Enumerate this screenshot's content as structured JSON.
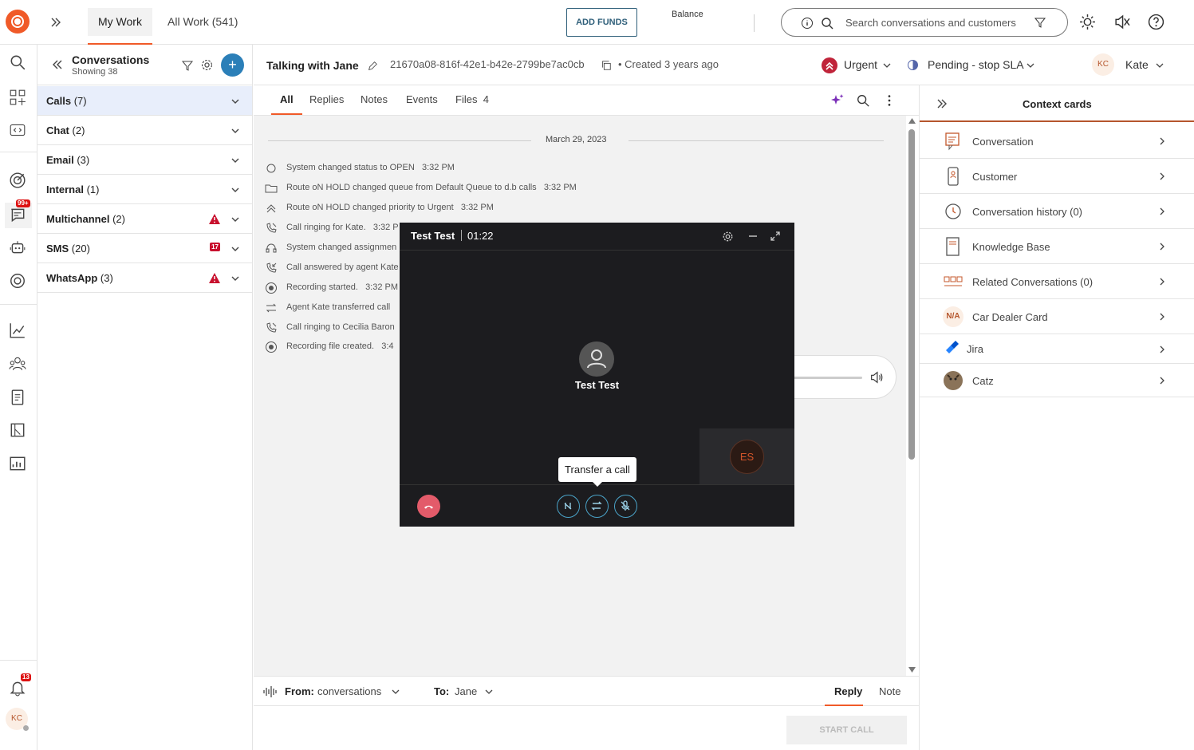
{
  "topbar": {
    "tabs": [
      {
        "label": "My Work",
        "active": true
      },
      {
        "label": "All Work (541)",
        "active": false
      }
    ],
    "add_funds_label": "ADD FUNDS",
    "balance_label": "Balance",
    "search_placeholder": "Search conversations and customers",
    "icons": [
      "info-icon",
      "search-icon",
      "filter-icon",
      "sun-icon",
      "mute-icon",
      "help-icon"
    ]
  },
  "rail": {
    "chat_badge": "99+",
    "notif_badge": "13",
    "avatar": "KC"
  },
  "conversations": {
    "title": "Conversations",
    "showing": "Showing 38",
    "groups": [
      {
        "name": "Calls",
        "count": "(7)",
        "active": true
      },
      {
        "name": "Chat",
        "count": "(2)"
      },
      {
        "name": "Email",
        "count": "(3)"
      },
      {
        "name": "Internal",
        "count": "(1)"
      },
      {
        "name": "Multichannel",
        "count": "(2)",
        "flag": "warning"
      },
      {
        "name": "SMS",
        "count": "(20)",
        "flag": "17"
      },
      {
        "name": "WhatsApp",
        "count": "(3)",
        "flag": "warning"
      }
    ]
  },
  "header": {
    "title": "Talking with Jane",
    "conversation_id": "21670a08-816f-42e1-b42e-2799be7ac0cb",
    "created": "• Created 3 years ago",
    "priority": "Urgent",
    "status": "Pending - stop SLA",
    "agent_initials": "KC",
    "agent_name": "Kate"
  },
  "tabs": [
    {
      "label": "All",
      "active": true
    },
    {
      "label": "Replies"
    },
    {
      "label": "Notes"
    },
    {
      "label": "Events"
    },
    {
      "label": "Files",
      "count": "4"
    }
  ],
  "timeline": {
    "date": "March 29, 2023",
    "events": [
      {
        "icon": "status-circle-icon",
        "text": "System changed status to OPEN",
        "time": "3:32 PM"
      },
      {
        "icon": "folder-icon",
        "text": "Route oN HOLD changed queue from Default Queue to d.b calls",
        "time": "3:32 PM"
      },
      {
        "icon": "priority-up-icon",
        "text": "Route oN HOLD changed priority to Urgent",
        "time": "3:32 PM"
      },
      {
        "icon": "phone-ringing-icon",
        "text": "Call ringing for Kate.",
        "time": "3:32 P"
      },
      {
        "icon": "headset-icon",
        "text": "System changed assignmen",
        "time": ""
      },
      {
        "icon": "phone-answer-icon",
        "text": "Call answered by agent Kate",
        "time": ""
      },
      {
        "icon": "record-icon",
        "text": "Recording started.",
        "time": "3:32 PM"
      },
      {
        "icon": "transfer-icon",
        "text": "Agent Kate transferred call",
        "time": ""
      },
      {
        "icon": "phone-ringing-icon",
        "text": "Call ringing to Cecilia Baron",
        "time": ""
      },
      {
        "icon": "record-icon",
        "text": "Recording file created.",
        "time": "3:4"
      }
    ]
  },
  "composer": {
    "from_label": "From:",
    "from_value": "conversations",
    "to_label": "To:",
    "to_value": "Jane",
    "reply_tab": "Reply",
    "note_tab": "Note",
    "start_call": "START CALL"
  },
  "context": {
    "title": "Context cards",
    "cards": [
      {
        "label": "Conversation",
        "icon": "conversation-icon"
      },
      {
        "label": "Customer",
        "icon": "customer-icon"
      },
      {
        "label": "Conversation history (0)",
        "icon": "history-icon"
      },
      {
        "label": "Knowledge Base",
        "icon": "book-icon"
      },
      {
        "label": "Related Conversations (0)",
        "icon": "related-icon"
      },
      {
        "label": "Car Dealer Card",
        "icon": "na-icon",
        "badge": "N/A"
      },
      {
        "label": "Jira",
        "icon": "jira-icon"
      },
      {
        "label": "Catz",
        "icon": "cat-avatar-icon"
      }
    ]
  },
  "call": {
    "name": "Test Test",
    "timer": "01:22",
    "caller": "Test Test",
    "self_initials": "ES",
    "tooltip": "Transfer a call"
  }
}
